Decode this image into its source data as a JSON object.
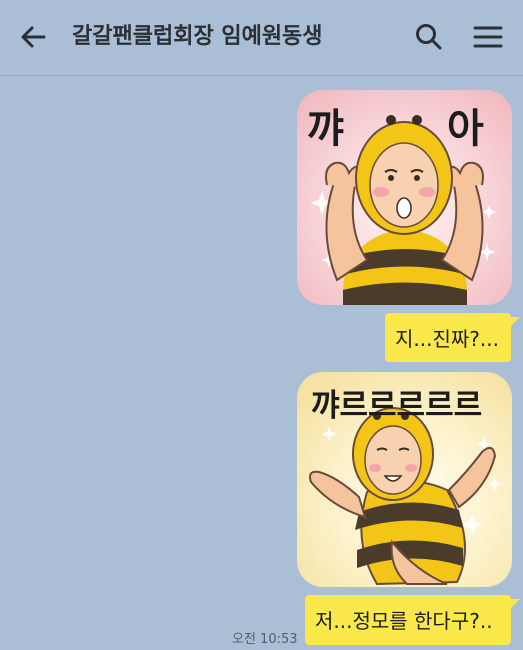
{
  "header": {
    "title": "갈갈팬클럽회장 임예원동생",
    "back_icon": "arrow-left-icon",
    "search_icon": "search-icon",
    "menu_icon": "hamburger-menu-icon"
  },
  "messages": [
    {
      "type": "sticker",
      "text_left": "꺄",
      "text_right": "아",
      "background": "#f6c9cf"
    },
    {
      "type": "text",
      "text": "지...진짜?..."
    },
    {
      "type": "sticker",
      "text": "꺄르르르르르",
      "background": "#fbf0c6"
    },
    {
      "type": "text",
      "text": "저...정모를 한다구?..",
      "time": "오전 10:53"
    }
  ],
  "colors": {
    "background": "#aabfd6",
    "bubble": "#fbe84a",
    "bee_yellow": "#f3c516",
    "bee_stripe": "#4a3b2b"
  }
}
